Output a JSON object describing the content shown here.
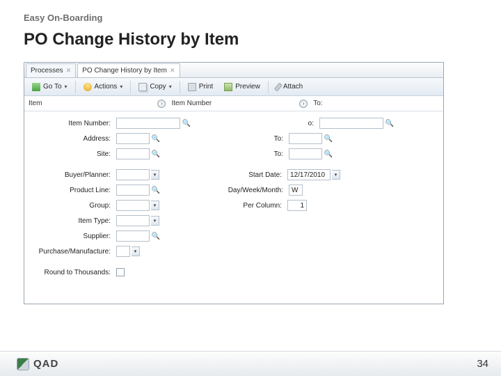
{
  "slide": {
    "breadcrumb": "Easy On-Boarding",
    "title": "PO Change History by Item",
    "page_number": "34",
    "brand": "QAD"
  },
  "tabs": [
    {
      "label": "Processes",
      "active": false
    },
    {
      "label": "PO Change History by Item",
      "active": true
    }
  ],
  "toolbar": {
    "goto": "Go To",
    "actions": "Actions",
    "copy": "Copy",
    "print": "Print",
    "preview": "Preview",
    "attach": "Attach"
  },
  "breadcrumb_row": {
    "item_label": "Item",
    "item_number_label": "Item Number",
    "to_label": "To:"
  },
  "form": {
    "item_number": {
      "label": "Item Number:",
      "value": ""
    },
    "item_number_to": {
      "label": "o:",
      "value": ""
    },
    "address": {
      "label": "Address:",
      "value": ""
    },
    "address_to": {
      "label": "To:",
      "value": ""
    },
    "site": {
      "label": "Site:",
      "value": ""
    },
    "site_to": {
      "label": "To:",
      "value": ""
    },
    "buyer_planner": {
      "label": "Buyer/Planner:",
      "value": ""
    },
    "start_date": {
      "label": "Start Date:",
      "value": "12/17/2010"
    },
    "product_line": {
      "label": "Product Line:",
      "value": ""
    },
    "day_week_month": {
      "label": "Day/Week/Month:",
      "value": "W"
    },
    "group": {
      "label": "Group:",
      "value": ""
    },
    "per_column": {
      "label": "Per Column:",
      "value": "1"
    },
    "item_type": {
      "label": "Item Type:",
      "value": ""
    },
    "supplier": {
      "label": "Supplier:",
      "value": ""
    },
    "purchase_manufacture": {
      "label": "Purchase/Manufacture:",
      "value": ""
    },
    "round_thousands": {
      "label": "Round to Thousands:"
    }
  }
}
